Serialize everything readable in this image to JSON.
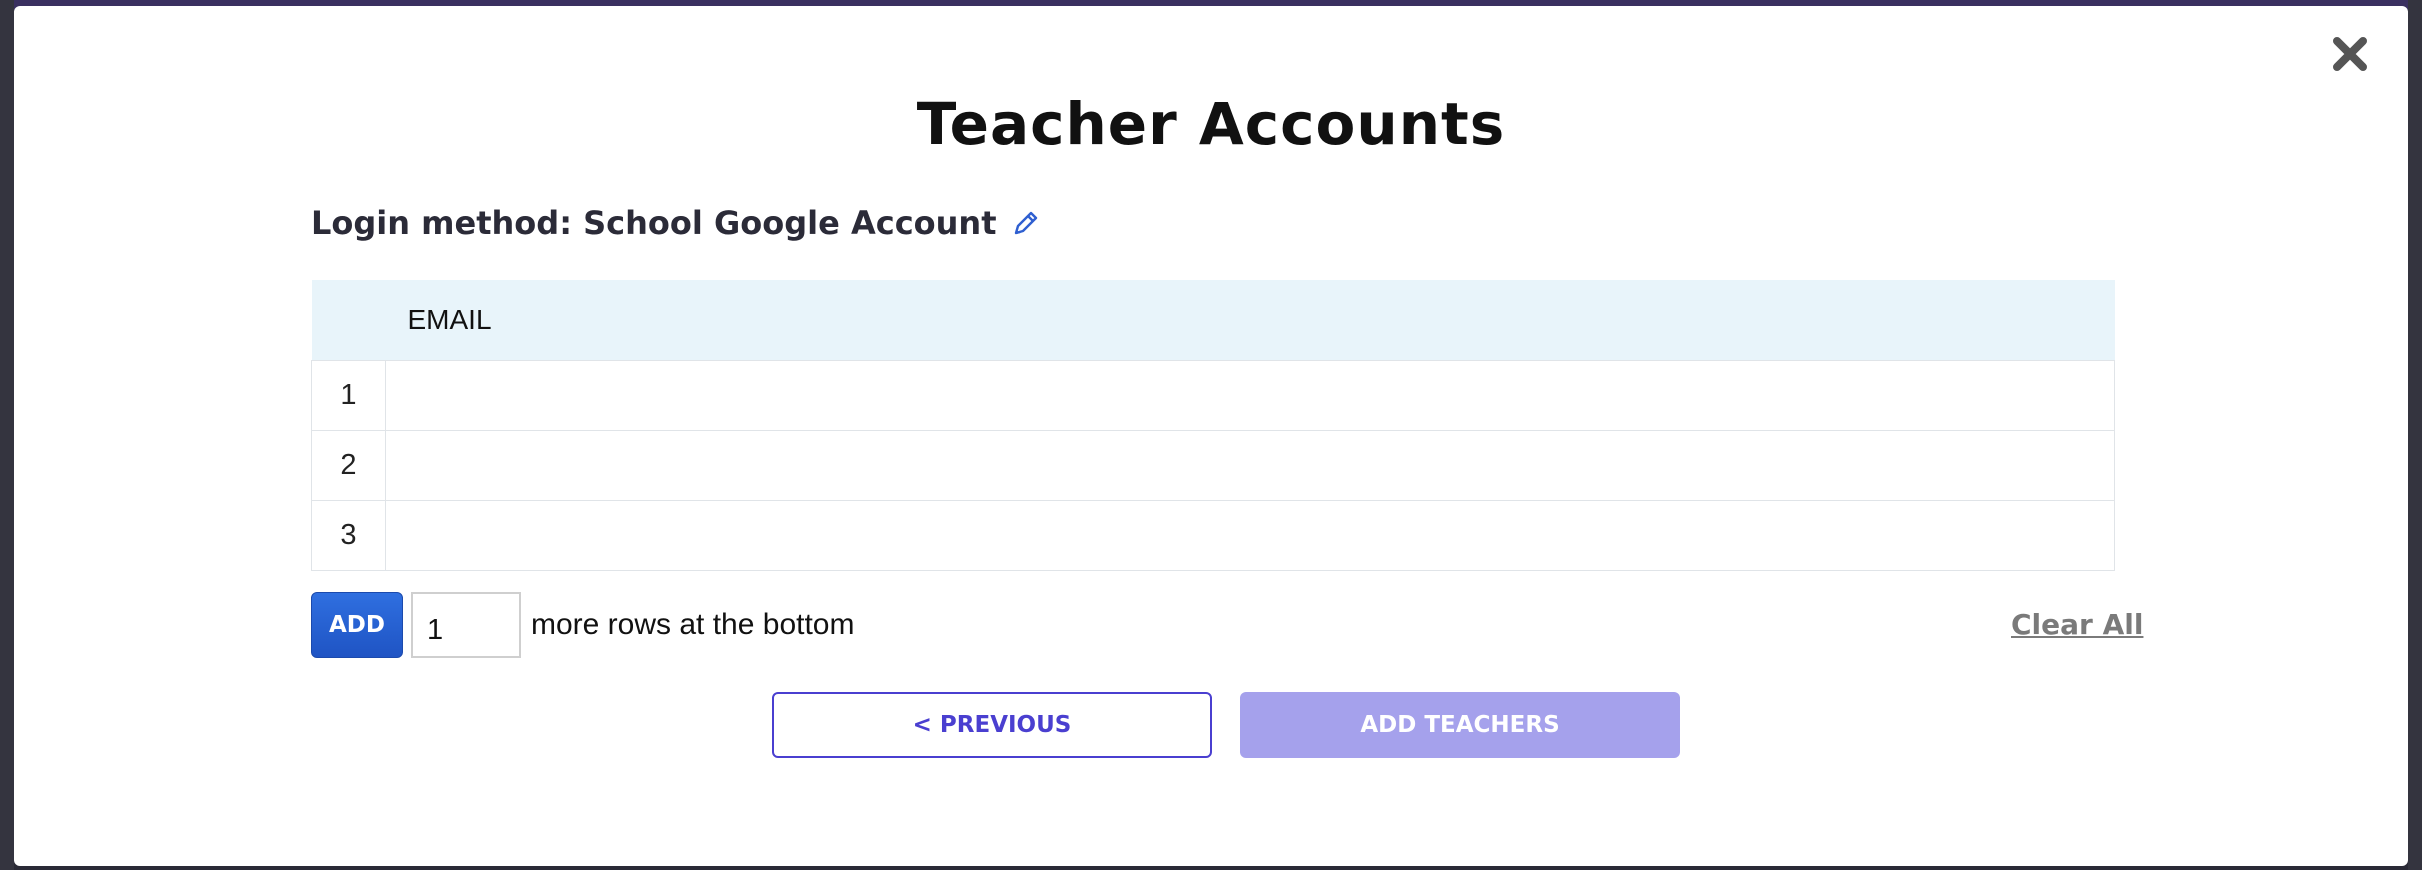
{
  "modal": {
    "title": "Teacher Accounts",
    "close_icon": "close-icon",
    "login_label": "Login method: School Google Account",
    "edit_icon": "pencil-icon"
  },
  "table": {
    "columns": [
      "",
      "EMAIL"
    ],
    "rows": [
      {
        "number": "1",
        "email": ""
      },
      {
        "number": "2",
        "email": ""
      },
      {
        "number": "3",
        "email": ""
      }
    ]
  },
  "add_rows": {
    "button_label": "ADD",
    "input_value": "1",
    "suffix": "more rows at the bottom"
  },
  "clear_all_label": "Clear All",
  "footer": {
    "previous_label": "< PREVIOUS",
    "add_teachers_label": "ADD TEACHERS"
  },
  "colors": {
    "primary": "#4a3fd0",
    "add_button": "#2563d9",
    "disabled_primary": "#a5a1ec",
    "table_header_bg": "#e8f4fa"
  }
}
